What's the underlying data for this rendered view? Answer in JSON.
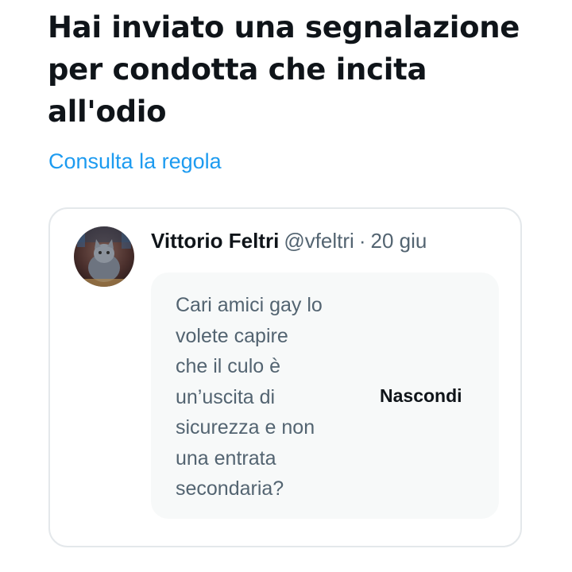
{
  "report": {
    "title": "Hai inviato una segnalazione per condotta che incita all'odio",
    "policy_link": "Consulta la regola"
  },
  "tweet": {
    "author_name": "Vittorio Feltri",
    "handle": "@vfeltri",
    "separator": "·",
    "date": "20 giu",
    "text": "Cari amici gay lo\nvolete capire\nche il culo  è\nun’uscita di\nsicurezza e non\nuna entrata\nsecondaria?",
    "hide_label": "Nascondi",
    "avatar_icon": "cat-profile-photo"
  },
  "colors": {
    "title": "#0f1419",
    "link": "#1d9bf0",
    "secondary_text": "#536471",
    "card_border": "#e4e8eb",
    "hidden_box_bg": "#f7f9f9"
  }
}
